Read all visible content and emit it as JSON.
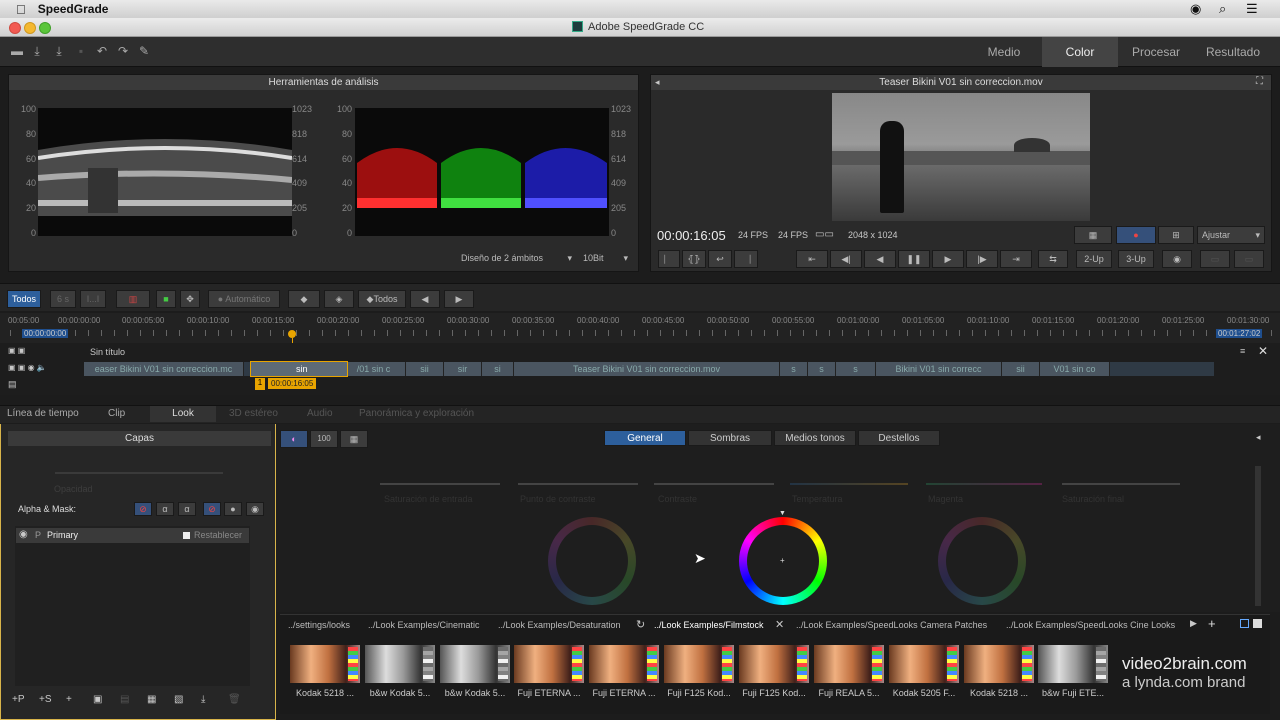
{
  "menubar": {
    "app_name": "SpeedGrade"
  },
  "window": {
    "title": "Adobe SpeedGrade CC"
  },
  "modes": {
    "tabs": [
      "Medio",
      "Color",
      "Procesar",
      "Resultado"
    ],
    "active": "Color"
  },
  "analysis": {
    "title": "Herramientas de análisis",
    "left_axis": [
      "100",
      "80",
      "60",
      "40",
      "20",
      "0"
    ],
    "right_axis": [
      "1023",
      "818",
      "614",
      "409",
      "205",
      "0"
    ],
    "layout_select": "Diseño de 2 ámbitos",
    "bits_select": "10Bit"
  },
  "viewer": {
    "title": "Teaser Bikini V01 sin correccion.mov",
    "timecode": "00:00:16:05",
    "fps1": "24 FPS",
    "fps2": "24 FPS",
    "resolution": "2048 x 1024",
    "fit_select": "Ajustar",
    "btn_2up": "2-Up",
    "btn_3up": "3-Up"
  },
  "timeline_toolbar": {
    "todos": "Todos",
    "six_s": "6 s",
    "dots": "I...I",
    "auto": "Automático",
    "todos2": "Todos"
  },
  "ruler": {
    "labels": [
      "00:05:00",
      "00:00:00:00",
      "00:00:05:00",
      "00:00:10:00",
      "00:00:15:00",
      "00:00:20:00",
      "00:00:25:00",
      "00:00:30:00",
      "00:00:35:00",
      "00:00:40:00",
      "00:00:45:00",
      "00:00:50:00",
      "00:00:55:00",
      "00:01:00:00",
      "00:01:05:00",
      "00:01:10:00",
      "00:01:15:00",
      "00:01:20:00",
      "00:01:25:00",
      "00:01:30:00"
    ],
    "in": "00:00:00:00",
    "out": "00:01:27:02"
  },
  "track": {
    "name": "Sin título",
    "clips": [
      "easer Bikini V01 sin correccion.mc",
      "sin",
      "i V01 sin con",
      "/01 sin c",
      "sii",
      "sir",
      "si",
      "Teaser Bikini V01 sin correccion.mov",
      "s",
      "s",
      "s",
      "Bikini V01 sin correcc",
      "sii",
      "V01 sin co"
    ],
    "current_tc": "00:00:16:05",
    "marker": "1"
  },
  "subtabs": {
    "items": [
      "Línea de tiempo",
      "Clip",
      "Look",
      "3D estéreo",
      "Audio",
      "Panorámica y exploración"
    ],
    "active": "Look"
  },
  "layers": {
    "title": "Capas",
    "opacity": "Opacidad",
    "alpha_mask": "Alpha & Mask:",
    "primary_label": "Primary",
    "primary_p": "P",
    "reset": "Restablecer",
    "bottom_buttons": [
      "+P",
      "+S",
      "+",
      "▣",
      "▤",
      "▦",
      "▧",
      "⤓",
      "🗑"
    ]
  },
  "look": {
    "tabs": [
      "General",
      "Sombras",
      "Medios tonos",
      "Destellos"
    ],
    "active_tab": "General",
    "sliders": [
      "Saturación de entrada",
      "Punto de contraste",
      "Contraste",
      "Temperatura",
      "Magenta",
      "Saturación final"
    ],
    "mode_buttons": [
      "◐",
      "100",
      "▦"
    ]
  },
  "browser": {
    "paths": [
      "../settings/looks",
      "../Look Examples/Cinematic",
      "../Look Examples/Desaturation",
      "../Look Examples/Filmstock",
      "../Look Examples/SpeedLooks Camera Patches",
      "../Look Examples/SpeedLooks Cine Looks"
    ],
    "active_path": "../Look Examples/Filmstock",
    "thumbs": [
      "Kodak 5218 ...",
      "b&w Kodak 5...",
      "b&w Kodak 5...",
      "Fuji ETERNA ...",
      "Fuji ETERNA ...",
      "Fuji F125 Kod...",
      "Fuji F125 Kod...",
      "Fuji REALA 5...",
      "Kodak 5205 F...",
      "Kodak 5218 ...",
      "b&w Fuji ETE..."
    ]
  },
  "watermark": {
    "line1": "video2brain.com",
    "line2": "a lynda.com brand"
  },
  "colors": {
    "accent": "#2d5f9c",
    "playhead": "#e8a400"
  }
}
